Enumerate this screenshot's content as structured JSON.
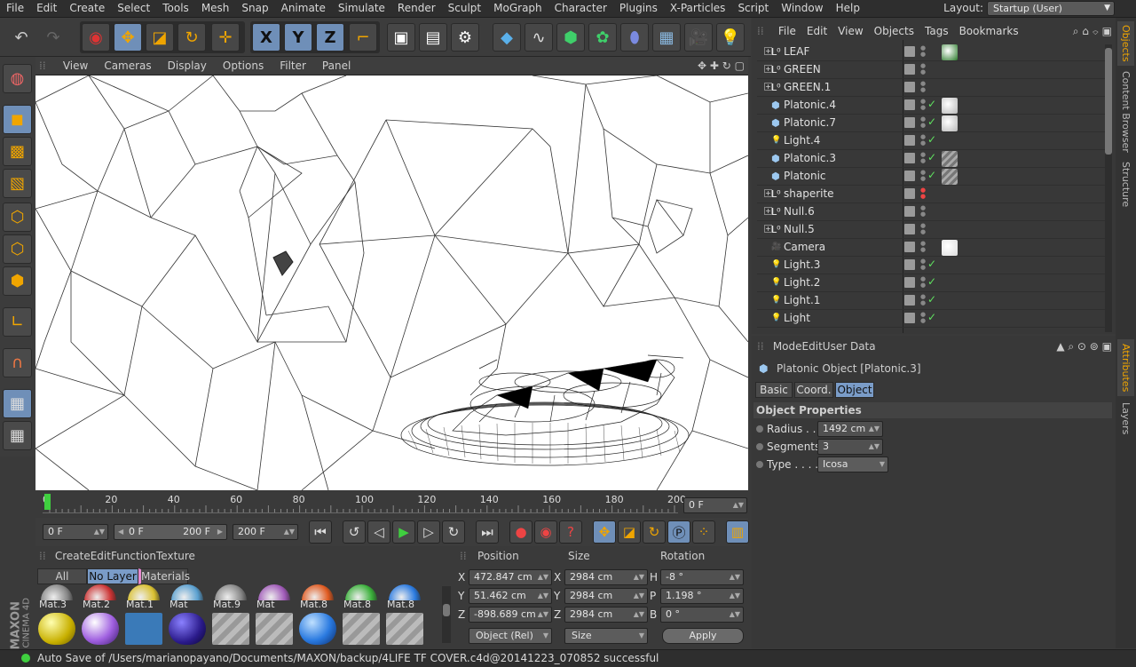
{
  "menubar": {
    "items": [
      "File",
      "Edit",
      "Create",
      "Select",
      "Tools",
      "Mesh",
      "Snap",
      "Animate",
      "Simulate",
      "Render",
      "Sculpt",
      "MoGraph",
      "Character",
      "Plugins",
      "X-Particles",
      "Script",
      "Window",
      "Help"
    ],
    "layout_label": "Layout:",
    "layout_value": "Startup (User)"
  },
  "toolbar": {
    "axis": [
      "X",
      "Y",
      "Z"
    ]
  },
  "viewport": {
    "menu": [
      "View",
      "Cameras",
      "Display",
      "Options",
      "Filter",
      "Panel"
    ]
  },
  "timeline": {
    "ticks": [
      "0",
      "20",
      "40",
      "60",
      "80",
      "100",
      "120",
      "140",
      "160",
      "180",
      "200"
    ],
    "frame_field": "0 F"
  },
  "transport": {
    "start": "0 F",
    "range_start": "0 F",
    "range_end": "200 F",
    "end": "200 F"
  },
  "materials": {
    "menu": [
      "Create",
      "Edit",
      "Function",
      "Texture"
    ],
    "filters": [
      "All",
      "No Layer",
      "Materials"
    ],
    "row1": [
      "Mat.3",
      "Mat.2",
      "Mat.1",
      "Mat",
      "Mat.9",
      "Mat",
      "Mat.8",
      "Mat.8",
      "Mat.8"
    ]
  },
  "coords": {
    "headers": [
      "Position",
      "Size",
      "Rotation"
    ],
    "pos": [
      {
        "axis": "X",
        "value": "472.847 cm"
      },
      {
        "axis": "Y",
        "value": "51.462 cm"
      },
      {
        "axis": "Z",
        "value": "-898.689 cm"
      }
    ],
    "size": [
      {
        "axis": "X",
        "value": "2984 cm"
      },
      {
        "axis": "Y",
        "value": "2984 cm"
      },
      {
        "axis": "Z",
        "value": "2984 cm"
      }
    ],
    "rot": [
      {
        "axis": "H",
        "value": "-8 °"
      },
      {
        "axis": "P",
        "value": "1.198 °"
      },
      {
        "axis": "B",
        "value": "0 °"
      }
    ],
    "mode": "Object (Rel)",
    "size_mode": "Size",
    "apply": "Apply"
  },
  "objects": {
    "menu": [
      "File",
      "Edit",
      "View",
      "Objects",
      "Tags",
      "Bookmarks"
    ],
    "rows": [
      {
        "name": "LEAF",
        "type": "null",
        "expand": true,
        "check": false,
        "tag": "#2a7a2a"
      },
      {
        "name": "GREEN",
        "type": "null",
        "expand": true,
        "check": false,
        "tag": ""
      },
      {
        "name": "GREEN.1",
        "type": "null",
        "expand": true,
        "check": false,
        "tag": ""
      },
      {
        "name": "Platonic.4",
        "type": "platonic",
        "expand": false,
        "check": true,
        "tag": "#b8b8b8"
      },
      {
        "name": "Platonic.7",
        "type": "platonic",
        "expand": false,
        "check": true,
        "tag": "#b8b8b8"
      },
      {
        "name": "Light.4",
        "type": "light",
        "expand": false,
        "check": true,
        "tag": ""
      },
      {
        "name": "Platonic.3",
        "type": "platonic",
        "expand": false,
        "check": true,
        "tag": "#8a8a8a"
      },
      {
        "name": "Platonic",
        "type": "platonic",
        "expand": false,
        "check": true,
        "tag": "#8a8a8a"
      },
      {
        "name": "shaperite",
        "type": "null",
        "expand": true,
        "check": false,
        "tag": ""
      },
      {
        "name": "Null.6",
        "type": "null",
        "expand": true,
        "check": false,
        "tag": ""
      },
      {
        "name": "Null.5",
        "type": "null",
        "expand": true,
        "check": false,
        "tag": ""
      },
      {
        "name": "Camera",
        "type": "camera",
        "expand": false,
        "check": false,
        "tag": "#dddddd"
      },
      {
        "name": "Light.3",
        "type": "light",
        "expand": false,
        "check": true,
        "tag": ""
      },
      {
        "name": "Light.2",
        "type": "light",
        "expand": false,
        "check": true,
        "tag": ""
      },
      {
        "name": "Light.1",
        "type": "light",
        "expand": false,
        "check": true,
        "tag": ""
      },
      {
        "name": "Light",
        "type": "light",
        "expand": false,
        "check": true,
        "tag": ""
      }
    ]
  },
  "attributes": {
    "menu": [
      "Mode",
      "Edit",
      "User Data"
    ],
    "title": "Platonic Object [Platonic.3]",
    "tabs": [
      "Basic",
      "Coord.",
      "Object"
    ],
    "section": "Object Properties",
    "props": [
      {
        "label": "Radius . .",
        "value": "1492 cm"
      },
      {
        "label": "Segments",
        "value": "3"
      },
      {
        "label": "Type . . . .",
        "value": "Icosa"
      }
    ]
  },
  "sidetabs": {
    "top": [
      "Objects",
      "Content Browser",
      "Structure"
    ],
    "bottom": [
      "Attributes",
      "Layers"
    ]
  },
  "brand": {
    "line1": "MAXON",
    "line2": "CINEMA 4D"
  },
  "status": {
    "text": "Auto Save of /Users/marianopayano/Documents/MAXON/backup/4LIFE TF COVER.c4d@20141223_070852 successful"
  }
}
